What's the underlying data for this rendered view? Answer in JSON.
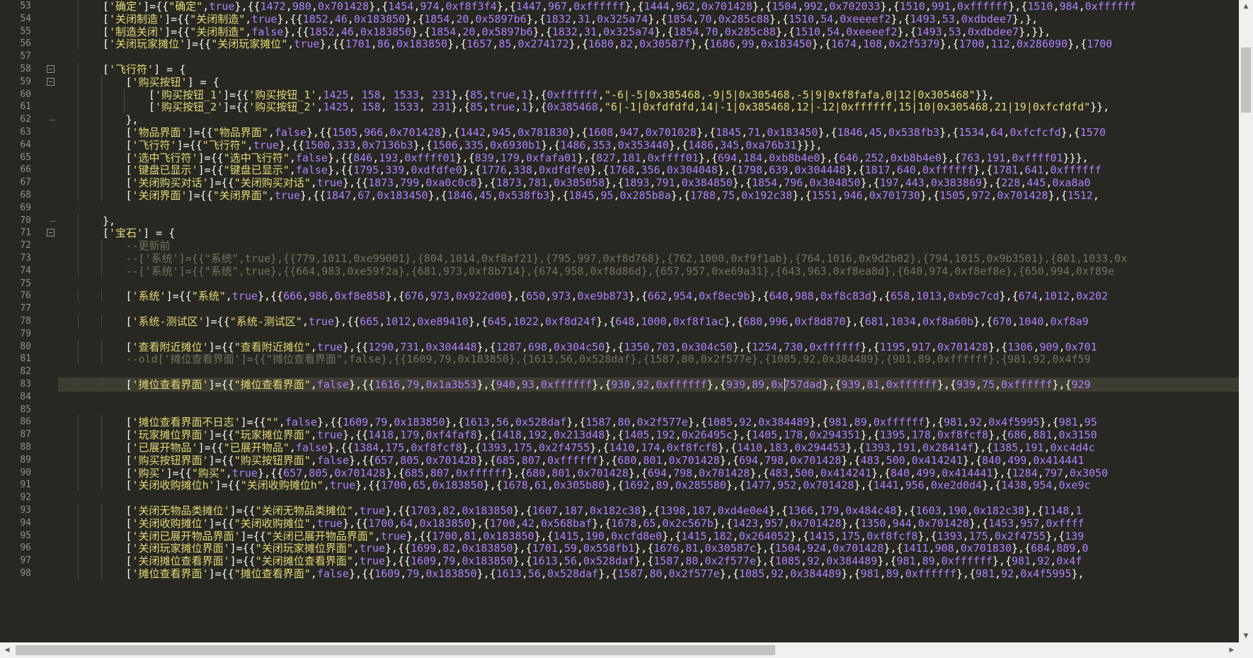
{
  "editor": {
    "theme": "monokai",
    "colors": {
      "background": "#272822",
      "text": "#f8f8f2",
      "string": "#e6db74",
      "number": "#ae81ff",
      "comment": "#75715e",
      "gutter": "#8f908a",
      "current_line": "#3e3d32"
    },
    "current_line_number": 83,
    "lines": [
      {
        "n": "53",
        "indent": 2,
        "text": "['确定']={{\"确定\",true},{{1472,980,0x701428},{1454,974,0xf8f3f4},{1447,967,0xffffff},{1444,962,0x701428},{1504,992,0x702033},{1510,991,0xffffff},{1510,984,0xffffff"
      },
      {
        "n": "54",
        "indent": 2,
        "text": "['关闭制造']={{\"关闭制造\",true},{{1852,46,0x183850},{1854,20,0x5897b6},{1832,31,0x325a74},{1854,70,0x285c88},{1510,54,0xeeeef2},{1493,53,0xdbdee7},},"
      },
      {
        "n": "55",
        "indent": 2,
        "text": "['制造关闭']={{\"关闭制造\",false},{{1852,46,0x183850},{1854,20,0x5897b6},{1832,31,0x325a74},{1854,70,0x285c88},{1510,54,0xeeeef2},{1493,53,0xdbdee7},}},"
      },
      {
        "n": "56",
        "indent": 2,
        "text": "['关闭玩家摊位']={{\"关闭玩家摊位\",true},{{1701,86,0x183850},{1657,85,0x274172},{1680,82,0x30587f},{1686,99,0x183450},{1674,108,0x2f5379},{1700,112,0x286090},{1700"
      },
      {
        "n": "57",
        "indent": 0,
        "text": ""
      },
      {
        "n": "58",
        "indent": 2,
        "text": "['飞行符'] = {",
        "fold": "open"
      },
      {
        "n": "59",
        "indent": 3,
        "text": "['购买按钮'] = {",
        "fold": "open"
      },
      {
        "n": "60",
        "indent": 4,
        "text": "['购买按钮_1']={{'购买按钮_1',1425, 158, 1533, 231},{85,true,1},{0xffffff,\"-6|-5|0x385468,-9|5|0x305468,-5|9|0xf8fafa,0|12|0x305468\"}},"
      },
      {
        "n": "61",
        "indent": 4,
        "text": "['购买按钮_2']={{'购买按钮_2',1425, 158, 1533, 231},{85,true,1},{0x385468,\"6|-1|0xfdfdfd,14|-1|0x385468,12|-12|0xffffff,15|10|0x305468,21|19|0xfcfdfd\"}},"
      },
      {
        "n": "62",
        "indent": 3,
        "text": "},",
        "fold": "end"
      },
      {
        "n": "63",
        "indent": 3,
        "text": "['物品界面']={{\"物品界面\",false},{{1505,966,0x701428},{1442,945,0x781830},{1608,947,0x701028},{1845,71,0x183450},{1846,45,0x538fb3},{1534,64,0xfcfcfd},{1570"
      },
      {
        "n": "64",
        "indent": 3,
        "text": "['飞行符']={{\"飞行符\",true},{{1500,333,0x7136b3},{1506,335,0x6930b1},{1486,353,0x353440},{1486,345,0xa76b31}}},"
      },
      {
        "n": "65",
        "indent": 3,
        "text": "['选中飞行符']={{\"选中飞行符\",false},{{846,193,0xffff01},{839,179,0xfafa01},{827,181,0xffff01},{694,184,0xb8b4e0},{646,252,0xb8b4e0},{763,191,0xffff01}}},"
      },
      {
        "n": "66",
        "indent": 3,
        "text": "['键盘已显示']={{\"键盘已显示\",false},{{1795,339,0xdfdfe0},{1776,338,0xdfdfe0},{1768,356,0x304048},{1798,639,0x304448},{1817,640,0xffffff},{1781,641,0xffffff"
      },
      {
        "n": "67",
        "indent": 3,
        "text": "['关闭购买对话']={{\"关闭购买对话\",true},{{1873,799,0xa0c0c8},{1873,781,0x385058},{1893,791,0x384850},{1854,796,0x304850},{197,443,0x383869},{228,445,0xa8a0"
      },
      {
        "n": "68",
        "indent": 3,
        "text": "['关闭界面']={{\"关闭界面\",true},{{1847,67,0x183450},{1846,45,0x538fb3},{1845,95,0x285b8a},{1788,75,0x192c38},{1551,946,0x701730},{1505,972,0x701428},{1512,"
      },
      {
        "n": "69",
        "indent": 0,
        "text": ""
      },
      {
        "n": "70",
        "indent": 2,
        "text": "},",
        "fold": "end"
      },
      {
        "n": "71",
        "indent": 2,
        "text": "['宝石'] = {",
        "fold": "open"
      },
      {
        "n": "72",
        "indent": 3,
        "text": "--更新前",
        "comment": true
      },
      {
        "n": "73",
        "indent": 3,
        "text": "--['系统']={{\"系统\",true},{{779,1011,0xe99001},{804,1014,0xf8af21},{795,997,0xf8d768},{762,1000,0xf9f1ab},{764,1016,0x9d2b02},{794,1015,0x9b3501},{801,1033,0x",
        "comment": true
      },
      {
        "n": "74",
        "indent": 3,
        "text": "--['系统']={{\"系统\",true},{{664,983,0xe59f2a},{681,973,0xf8b714},{674,958,0xf8d86d},{657,957,0xe69a31},{643,963,0xf8ea8d},{640,974,0xf8ef8e},{650,994,0xf89e",
        "comment": true
      },
      {
        "n": "75",
        "indent": 0,
        "text": ""
      },
      {
        "n": "76",
        "indent": 3,
        "text": "['系统']={{\"系统\",true},{{666,986,0xf8e858},{676,973,0x922d00},{650,973,0xe9b873},{662,954,0xf8ec9b},{640,988,0xf8c83d},{658,1013,0xb9c7cd},{674,1012,0x202"
      },
      {
        "n": "77",
        "indent": 0,
        "text": ""
      },
      {
        "n": "78",
        "indent": 3,
        "text": "['系统-测试区']={{\"系统-测试区\",true},{{665,1012,0xe89410},{645,1022,0xf8d24f},{648,1000,0xf8f1ac},{680,996,0xf8d870},{681,1034,0xf8a60b},{670,1040,0xf8a9"
      },
      {
        "n": "79",
        "indent": 0,
        "text": ""
      },
      {
        "n": "80",
        "indent": 3,
        "text": "['查看附近摊位']={{\"查看附近摊位\",true},{{1290,731,0x304448},{1287,698,0x304c50},{1350,703,0x304c50},{1254,730,0xffffff},{1195,917,0x701428},{1306,909,0x701"
      },
      {
        "n": "81",
        "indent": 3,
        "text": "--old['摊位查看界面']={{\"摊位查看界面\",false},{{1609,79,0x183850},{1613,56,0x528daf},{1587,80,0x2f577e},{1085,92,0x384489},{981,89,0xffffff},{981,92,0x4f59",
        "comment": true
      },
      {
        "n": "82",
        "indent": 0,
        "text": ""
      },
      {
        "n": "83",
        "indent": 3,
        "text": "['摊位查看界面']={{\"摊位查看界面\",false},{{1616,79,0x1a3b53},{940,93,0xffffff},{930,92,0xffffff},{939,89,0x757dad},{939,81,0xffffff},{939,75,0xffffff},{929"
      },
      {
        "n": "84",
        "indent": 0,
        "text": ""
      },
      {
        "n": "85",
        "indent": 0,
        "text": ""
      },
      {
        "n": "86",
        "indent": 3,
        "text": "['摊位查看界面不日志']={{\"\",false},{{1609,79,0x183850},{1613,56,0x528daf},{1587,80,0x2f577e},{1085,92,0x384489},{981,89,0xffffff},{981,92,0x4f5995},{981,95"
      },
      {
        "n": "87",
        "indent": 3,
        "text": "['玩家摊位界面']={{\"玩家摊位界面\",true},{{1418,179,0xf4faf8},{1418,192,0x213d48},{1405,192,0x26495c},{1405,178,0x294351},{1395,178,0xf8fcf8},{686,881,0x3150"
      },
      {
        "n": "88",
        "indent": 3,
        "text": "['已展开物品']={{\"已展开物品\",false},{{1384,175,0xf8fcf8},{1393,175,0x2f4755},{1410,174,0xf8fcf8},{1410,183,0x294453},{1393,191,0x28414f},{1385,191,0xc4d4c"
      },
      {
        "n": "89",
        "indent": 3,
        "text": "['购买按钮界面']={{\"购买按钮界面\",false},{{657,805,0x701428},{685,807,0xffffff},{680,801,0x701428},{694,798,0x701428},{483,500,0x414241},{840,499,0x414441"
      },
      {
        "n": "90",
        "indent": 3,
        "text": "['购买']={{\"购买\",true},{{657,805,0x701428},{685,807,0xffffff},{680,801,0x701428},{694,798,0x701428},{483,500,0x414241},{840,499,0x414441},{1284,797,0x3050"
      },
      {
        "n": "91",
        "indent": 3,
        "text": "['关闭收购摊位h']={{\"关闭收购摊位h\",true},{{1700,65,0x183850},{1678,61,0x305b80},{1692,89,0x285580},{1477,952,0x701428},{1441,956,0xe2d0d4},{1438,954,0xe9c"
      },
      {
        "n": "92",
        "indent": 0,
        "text": ""
      },
      {
        "n": "93",
        "indent": 3,
        "text": "['关闭无物品类摊位']={{\"关闭无物品类摊位\",true},{{1703,82,0x183850},{1607,187,0x182c38},{1398,187,0xd4e0e4},{1366,179,0x484c48},{1603,190,0x182c38},{1148,1"
      },
      {
        "n": "94",
        "indent": 3,
        "text": "['关闭收购摊位']={{\"关闭收购摊位\",true},{{1700,64,0x183850},{1700,42,0x568baf},{1678,65,0x2c567b},{1423,957,0x701428},{1350,944,0x701428},{1453,957,0xffff"
      },
      {
        "n": "95",
        "indent": 3,
        "text": "['关闭已展开物品界面']={{\"关闭已展开物品界面\",true},{{1700,81,0x183850},{1415,190,0xcfd8e0},{1415,182,0x264052},{1415,175,0xf8fcf8},{1393,175,0x2f4755},{139"
      },
      {
        "n": "96",
        "indent": 3,
        "text": "['关闭玩家摊位界面']={{\"关闭玩家摊位界面\",true},{{1699,82,0x183850},{1701,59,0x558fb1},{1676,81,0x30587c},{1504,924,0x701428},{1411,908,0x701830},{684,889,0"
      },
      {
        "n": "97",
        "indent": 3,
        "text": "['关闭摊位查看界面']={{\"关闭摊位查看界面\",true},{{1609,79,0x183850},{1613,56,0x528daf},{1587,80,0x2f577e},{1085,92,0x384489},{981,89,0xffffff},{981,92,0x4f"
      },
      {
        "n": "98",
        "indent": 3,
        "text": "['摊位查看界面']={{\"摊位查看界面\",false},{{1609,79,0x183850},{1613,56,0x528daf},{1587,80,0x2f577e},{1085,92,0x384489},{981,89,0xffffff},{981,92,0x4f5995},"
      }
    ]
  },
  "scrollbars": {
    "vertical_position": 0.06,
    "horizontal_position": 0.0,
    "up_arrow": "▲",
    "down_arrow": "▼",
    "left_arrow": "◀",
    "right_arrow": "▶"
  }
}
